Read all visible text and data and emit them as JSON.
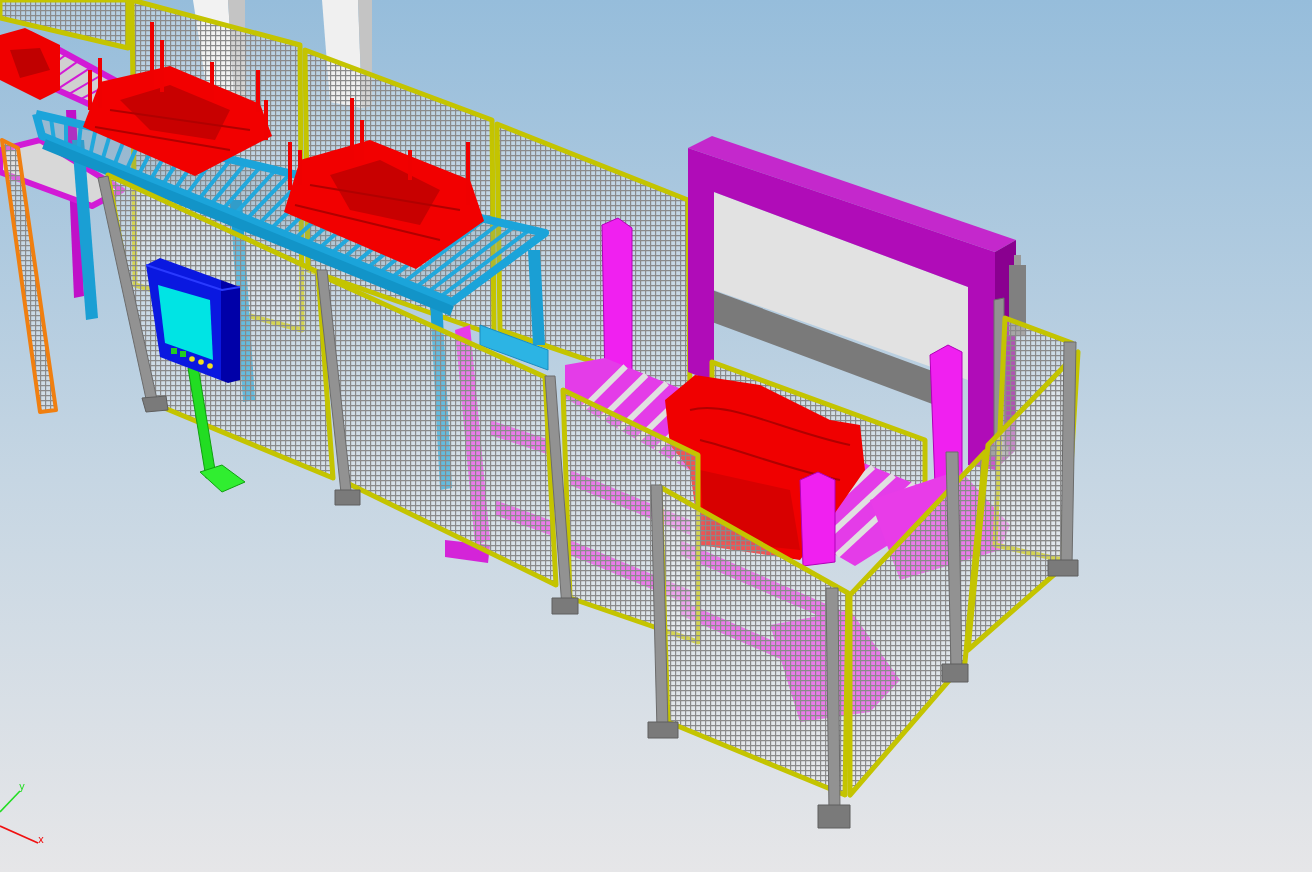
{
  "viewport": {
    "axes": [
      {
        "kind": "y",
        "label": "y",
        "color": "#22dd22"
      },
      {
        "kind": "x",
        "label": "x",
        "color": "#f01010"
      }
    ]
  }
}
